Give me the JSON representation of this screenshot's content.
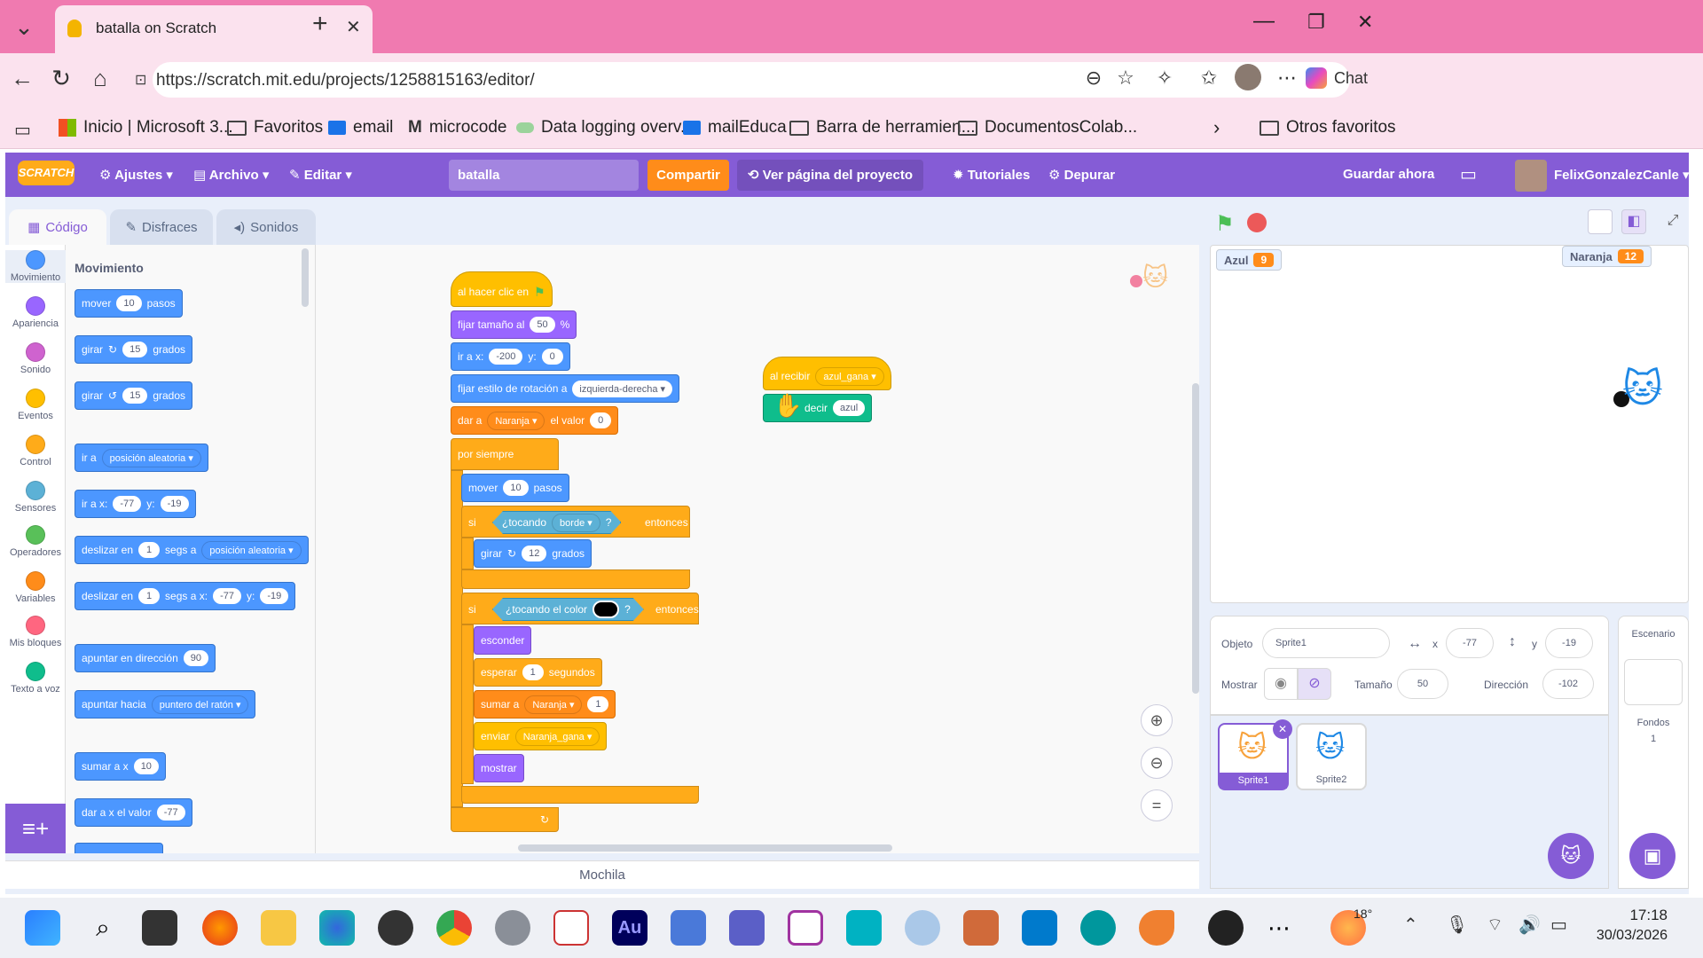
{
  "browser": {
    "tab_title": "batalla on Scratch",
    "new_tab": "+",
    "url": "https://scratch.mit.edu/projects/1258815163/editor/",
    "copilot": "Chat",
    "bookmarks": [
      "Inicio | Microsoft 3...",
      "Favoritos",
      "email",
      "microcode",
      "Data logging overv...",
      "mailEduca",
      "Barra de herramien...",
      "DocumentosColab..."
    ],
    "other_favorites": "Otros favoritos"
  },
  "menu": {
    "logo": "SCRATCH",
    "settings": "Ajustes",
    "file": "Archivo",
    "edit": "Editar",
    "project_title": "batalla",
    "share": "Compartir",
    "see_project": "Ver página del proyecto",
    "tutorials": "Tutoriales",
    "debug": "Depurar",
    "save": "Guardar ahora",
    "user": "FelixGonzalezCanle"
  },
  "tabs": {
    "code": "Código",
    "costumes": "Disfraces",
    "sounds": "Sonidos"
  },
  "categories": [
    {
      "label": "Movimiento",
      "color": "#4c97ff"
    },
    {
      "label": "Apariencia",
      "color": "#9966ff"
    },
    {
      "label": "Sonido",
      "color": "#cf63cf"
    },
    {
      "label": "Eventos",
      "color": "#ffbf00"
    },
    {
      "label": "Control",
      "color": "#ffab19"
    },
    {
      "label": "Sensores",
      "color": "#5cb1d6"
    },
    {
      "label": "Operadores",
      "color": "#59c059"
    },
    {
      "label": "Variables",
      "color": "#ff8c1a"
    },
    {
      "label": "Mis bloques",
      "color": "#ff6680"
    },
    {
      "label": "Texto a voz",
      "color": "#0fbd8c"
    }
  ],
  "palette": {
    "heading": "Movimiento",
    "move": [
      "mover",
      "10",
      "pasos"
    ],
    "turn_right": [
      "girar",
      "15",
      "grados"
    ],
    "turn_left": [
      "girar",
      "15",
      "grados"
    ],
    "goto": [
      "ir a",
      "posición aleatoria"
    ],
    "goto_xy": [
      "ir a x:",
      "-77",
      "y:",
      "-19"
    ],
    "glide_to": [
      "deslizar en",
      "1",
      "segs a",
      "posición aleatoria"
    ],
    "glide_xy": [
      "deslizar en",
      "1",
      "segs a x:",
      "-77",
      "y:",
      "-19"
    ],
    "point_dir": [
      "apuntar en dirección",
      "90"
    ],
    "point_towards": [
      "apuntar hacia",
      "puntero del ratón"
    ],
    "change_x": [
      "sumar a x",
      "10"
    ],
    "set_x": [
      "dar a x el valor",
      "-77"
    ]
  },
  "script1": {
    "hat": "al hacer clic en",
    "size": [
      "fijar tamaño al",
      "50",
      "%"
    ],
    "goto": [
      "ir a x:",
      "-200",
      "y:",
      "0"
    ],
    "rotation": [
      "fijar estilo de rotación a",
      "izquierda-derecha"
    ],
    "setvar": [
      "dar a",
      "Naranja",
      "el valor",
      "0"
    ],
    "forever": "por siempre",
    "move": [
      "mover",
      "10",
      "pasos"
    ],
    "if1": [
      "si",
      "¿tocando",
      "borde",
      "?",
      "entonces"
    ],
    "turn": [
      "girar",
      "12",
      "grados"
    ],
    "if2": [
      "si",
      "¿tocando el color",
      "?",
      "entonces"
    ],
    "hide": "esconder",
    "wait": [
      "esperar",
      "1",
      "segundos"
    ],
    "change": [
      "sumar a",
      "Naranja",
      "1"
    ],
    "broadcast": [
      "enviar",
      "Naranja_gana"
    ],
    "show": "mostrar"
  },
  "script2": {
    "hat": [
      "al recibir",
      "azul_gana"
    ],
    "say": [
      "decir",
      "azul"
    ]
  },
  "mochila": "Mochila",
  "stage": {
    "monitors": [
      {
        "name": "Azul",
        "value": "9"
      },
      {
        "name": "Naranja",
        "value": "12"
      }
    ]
  },
  "sprite_info": {
    "object_label": "Objeto",
    "sprite_name": "Sprite1",
    "x_label": "x",
    "x": "-77",
    "y_label": "y",
    "y": "-19",
    "show_label": "Mostrar",
    "size_label": "Tamaño",
    "size": "50",
    "direction_label": "Dirección",
    "direction": "-102"
  },
  "sprites": [
    "Sprite1",
    "Sprite2"
  ],
  "stage_pane": {
    "title": "Escenario",
    "backdrops_label": "Fondos",
    "backdrops_count": "1"
  },
  "taskbar": {
    "temp": "18°",
    "time": "17:18",
    "date": "30/03/2026"
  }
}
